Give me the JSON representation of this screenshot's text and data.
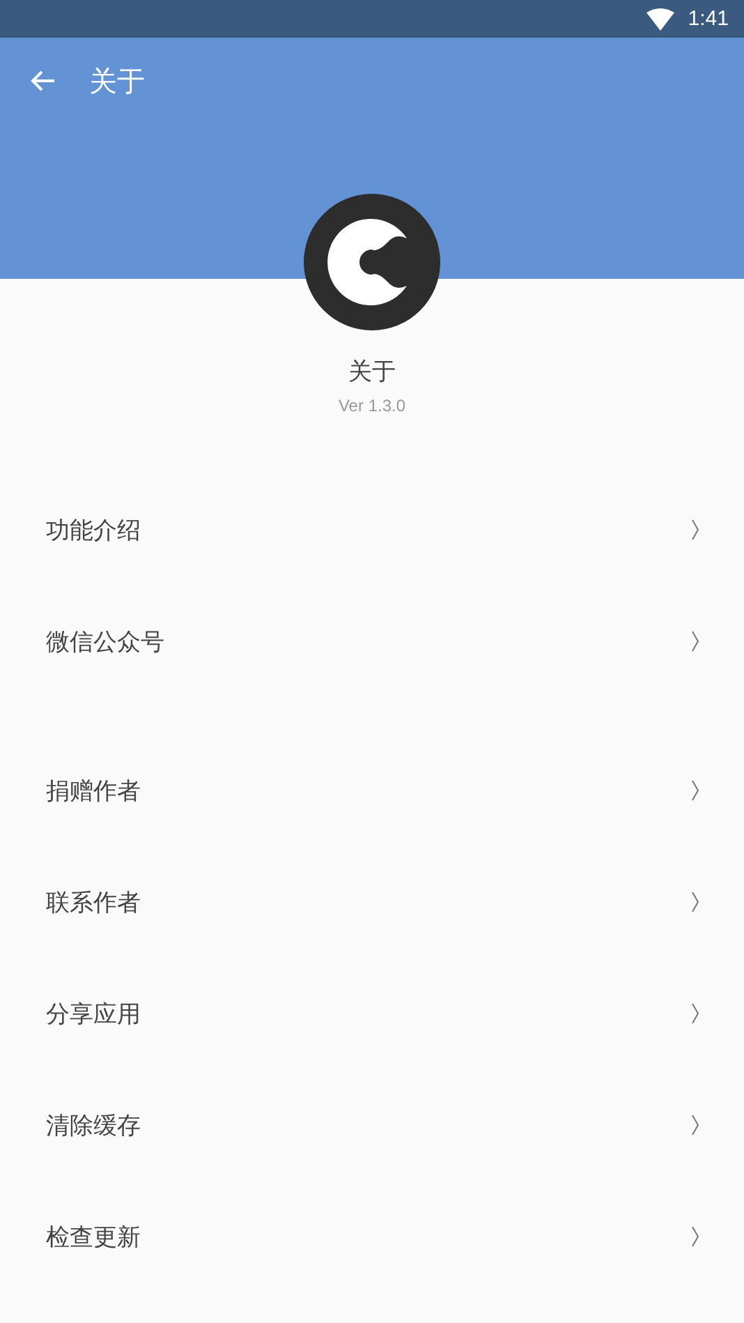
{
  "status_bar": {
    "time": "1:41"
  },
  "toolbar": {
    "title": "关于"
  },
  "app": {
    "name": "关于",
    "version": "Ver 1.3.0"
  },
  "groups": [
    {
      "items": [
        {
          "label": "功能介绍"
        },
        {
          "label": "微信公众号"
        }
      ]
    },
    {
      "items": [
        {
          "label": "捐赠作者"
        },
        {
          "label": "联系作者"
        },
        {
          "label": "分享应用"
        },
        {
          "label": "清除缓存"
        },
        {
          "label": "检查更新"
        }
      ]
    }
  ]
}
